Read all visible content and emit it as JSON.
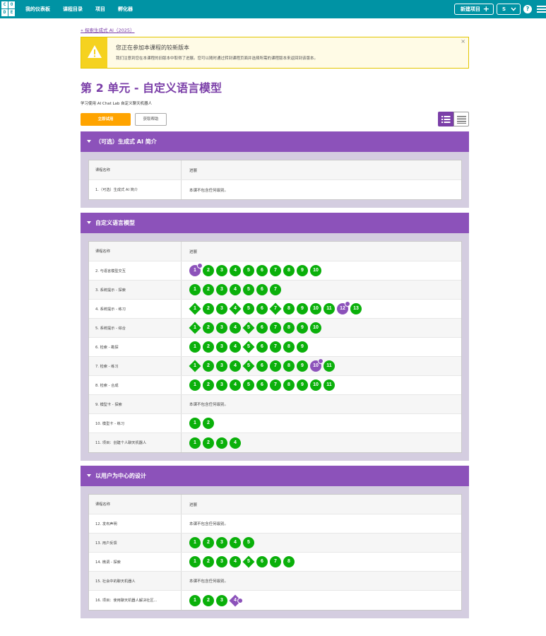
{
  "header": {
    "logo_letters": [
      "C",
      "O",
      "D",
      "E"
    ],
    "nav": [
      "我的仪表板",
      "课程目录",
      "项目",
      "孵化器"
    ],
    "new_project": "新建项目",
    "user": "S",
    "help": "?"
  },
  "back_link": "« 探索生成式 AI（2025）",
  "notice": {
    "title": "您正在参加本课程的较新版本",
    "body": "我们注意到您在本课程的旧版本中取得了进展。您可以随时通过转到课程页面并选择所需的课程版本来返回到该版本。",
    "close": "×"
  },
  "page": {
    "title": "第 2 单元 - 自定义语言模型",
    "subtitle": "学习使用 AI Chat Lab 自定义聊天机器人",
    "try_now": "立即试用",
    "get_help": "获取帮助"
  },
  "table_headers": {
    "name": "课程名称",
    "progress": "进展"
  },
  "colors": {
    "teal": "#0093a4",
    "purple": "#8c52ba",
    "green": "#0ab00a",
    "orange": "#ffa400"
  },
  "sections": [
    {
      "title": "（可选）生成式 AI 简介",
      "lessons": [
        {
          "name": "1.（可选）生成式 AI 简介",
          "text": "本课不包含任何级别。"
        }
      ]
    },
    {
      "title": "自定义语言模型",
      "lessons": [
        {
          "name": "2. 与语言模型交互",
          "levels": [
            {
              "n": "1",
              "cur": true
            },
            "2",
            "3",
            "4",
            "5",
            "6",
            "7",
            "8",
            "9",
            "10"
          ]
        },
        {
          "name": "3. 系统提示 - 探索",
          "levels": [
            "1",
            "2",
            "3",
            "4",
            "5",
            "6",
            "7"
          ]
        },
        {
          "name": "4. 系统提示 - 练习",
          "levels": [
            {
              "n": "1",
              "d": true
            },
            "2",
            "3",
            {
              "n": "4",
              "d": true
            },
            "5",
            "6",
            {
              "n": "7",
              "d": true
            },
            "8",
            "9",
            "10",
            "11",
            {
              "n": "12",
              "cur": true
            },
            "13"
          ]
        },
        {
          "name": "5. 系统提示 - 综合",
          "levels": [
            {
              "n": "1",
              "d": true
            },
            "2",
            "3",
            "4",
            {
              "n": "5",
              "d": true
            },
            "6",
            "7",
            "8",
            "9",
            "10"
          ]
        },
        {
          "name": "6. 检索 - 勘探",
          "levels": [
            "1",
            "2",
            "3",
            "4",
            {
              "n": "5",
              "d": true
            },
            "6",
            "7",
            "8",
            "9"
          ]
        },
        {
          "name": "7. 检索 - 练习",
          "levels": [
            {
              "n": "1",
              "d": true
            },
            "2",
            "3",
            "4",
            {
              "n": "5",
              "d": true
            },
            "6",
            "7",
            "8",
            "9",
            {
              "n": "10",
              "cur": true
            },
            "11"
          ]
        },
        {
          "name": "8. 检索 - 合成",
          "levels": [
            "1",
            "2",
            "3",
            "4",
            "5",
            "6",
            "7",
            "8",
            "9",
            "10",
            "11"
          ]
        },
        {
          "name": "9. 模型卡 - 探索",
          "text": "本课不包含任何级别。"
        },
        {
          "name": "10. 模型卡 - 练习",
          "levels": [
            "1",
            "2"
          ]
        },
        {
          "name": "11. 项目：创建个人聊天机器人",
          "levels": [
            "1",
            "2",
            "3",
            "4"
          ]
        }
      ]
    },
    {
      "title": "以用户为中心的设计",
      "lessons": [
        {
          "name": "12. 发布声明",
          "text": "本课不包含任何级别。"
        },
        {
          "name": "13. 用户反馈",
          "levels": [
            "1",
            "2",
            "3",
            "4",
            "5"
          ]
        },
        {
          "name": "14. 微调 - 探索",
          "levels": [
            "1",
            "2",
            "3",
            "4",
            {
              "n": "5",
              "d": true
            },
            "6",
            "7",
            "8"
          ]
        },
        {
          "name": "15. 社会中的聊天机器人",
          "text": "本课不包含任何级别。"
        },
        {
          "name": "16. 项目：使用聊天机器人解决社区...",
          "levels": [
            "1",
            "2",
            "3",
            {
              "n": "4",
              "d": true,
              "cur": true
            }
          ]
        }
      ]
    }
  ]
}
